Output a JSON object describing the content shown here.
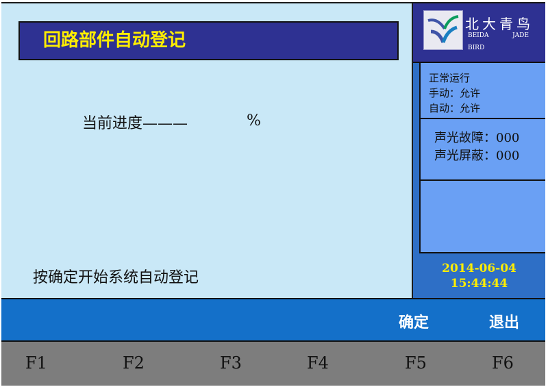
{
  "main": {
    "title": "回路部件自动登记",
    "progress_label": "当前进度———",
    "progress_percent_sign": "%",
    "instruction": "按确定开始系统自动登记"
  },
  "logo": {
    "name": "北大青鸟",
    "en_part1": "BEIDA",
    "en_part2": "JADE",
    "en_part3": "BIRD"
  },
  "status": {
    "line1": "正常运行",
    "line2": "手动：允许",
    "line3": "自动：允许"
  },
  "faults": {
    "line1": "声光故障：000",
    "line2": "声光屏蔽：000"
  },
  "datetime": {
    "date": "2014-06-04",
    "time": "15:44:44"
  },
  "commands": {
    "confirm": "确定",
    "exit": "退出"
  },
  "fkeys": [
    "F1",
    "F2",
    "F3",
    "F4",
    "F5",
    "F6"
  ],
  "colors": {
    "title_bg": "#2e3192",
    "title_text": "#ffee00",
    "panel_bg": "#c9e8f7",
    "status_bg": "#6aa0f4",
    "command_bar": "#1470c9",
    "fkey_bar": "#7d7d7d"
  },
  "icons": {
    "logo": "jade-bird-emblem-icon"
  }
}
